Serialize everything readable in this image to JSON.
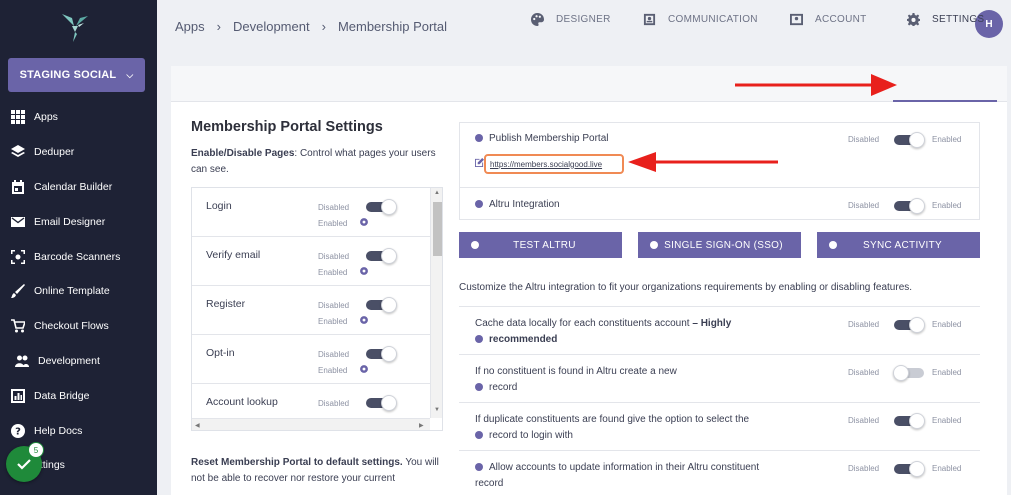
{
  "sidebar": {
    "org_label": "STAGING SOCIAL",
    "items": [
      {
        "label": "Apps",
        "icon": "grid-icon"
      },
      {
        "label": "Deduper",
        "icon": "layers-icon"
      },
      {
        "label": "Calendar Builder",
        "icon": "calendar-icon"
      },
      {
        "label": "Email Designer",
        "icon": "mail-icon"
      },
      {
        "label": "Barcode Scanners",
        "icon": "scan-icon"
      },
      {
        "label": "Online Template",
        "icon": "brush-icon"
      },
      {
        "label": "Checkout Flows",
        "icon": "cart-icon"
      },
      {
        "label": "Development",
        "icon": "people-icon"
      },
      {
        "label": "Data Bridge",
        "icon": "chart-icon"
      },
      {
        "label": "Help Docs",
        "icon": "help-icon"
      },
      {
        "label": "ettings",
        "icon": "settings-icon"
      }
    ],
    "badge_count": "5"
  },
  "breadcrumb": [
    "Apps",
    "Development",
    "Membership Portal"
  ],
  "avatar_initial": "H",
  "tabs": [
    {
      "label": "DESIGNER",
      "icon": "palette-icon"
    },
    {
      "label": "COMMUNICATION",
      "icon": "contact-card-icon"
    },
    {
      "label": "ACCOUNT",
      "icon": "account-icon"
    },
    {
      "label": "SETTINGS",
      "icon": "gear-icon"
    }
  ],
  "left": {
    "title": "Membership Portal Settings",
    "desc_bold": "Enable/Disable Pages",
    "desc_rest": ": Control what pages your users can see.",
    "pages": [
      {
        "label": "Login"
      },
      {
        "label": "Verify email"
      },
      {
        "label": "Register"
      },
      {
        "label": "Opt-in"
      },
      {
        "label": "Account lookup"
      }
    ],
    "disabled_label": "Disabled",
    "enabled_label": "Enabled",
    "reset_bold": "Reset Membership Portal to default settings.",
    "reset_rest": " You will not be able to recover nor restore your current"
  },
  "right": {
    "publish_label": "Publish Membership Portal",
    "publish_url": "https://members.socialgood.live",
    "altru_label": "Altru Integration",
    "buttons": [
      "TEST ALTRU",
      "SINGLE SIGN-ON (SSO)",
      "SYNC ACTIVITY"
    ],
    "customize_text": "Customize the Altru integration to fit your organizations requirements by enabling or disabling features.",
    "rows": [
      {
        "line1": "Cache data locally for each constituents account ",
        "line1_bold": "– Highly",
        "line2_bold": "recommended"
      },
      {
        "line1": "If no constituent is found in Altru create a new",
        "line2": "record"
      },
      {
        "line1": "If duplicate constituents are found give the option to select the",
        "line2": "record to login with"
      },
      {
        "line1": "Allow accounts to update information in their Altru constituent",
        "line2": "record"
      }
    ],
    "disabled_label": "Disabled",
    "enabled_label": "Enabled"
  },
  "colors": {
    "accent": "#6a64a8",
    "sidebar": "#1e2235",
    "annotation": "#e8201c"
  }
}
